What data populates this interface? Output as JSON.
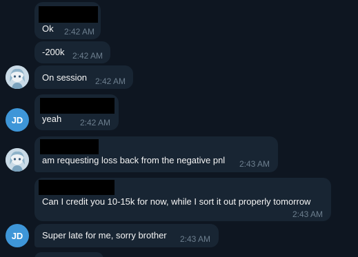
{
  "colors": {
    "background": "#0e1621",
    "bubble": "#182533",
    "text": "#f5f5f5",
    "timestamp": "#6d7f8f",
    "avatar_jd": "#3e96d8",
    "redaction": "#000000"
  },
  "messages": [
    {
      "text": "Ok",
      "time": "2:42 AM",
      "redacted_header": true
    },
    {
      "text": "-200k",
      "time": "2:42 AM",
      "redacted_header": false
    },
    {
      "text": "On session",
      "time": "2:42 AM",
      "redacted_header": false,
      "avatar": "anime-avatar-icon"
    },
    {
      "text": "yeah",
      "time": "2:42 AM",
      "redacted_header": true,
      "avatar": "JD"
    },
    {
      "text": "am requesting loss back from the negative pnl",
      "time": "2:43 AM",
      "redacted_header": true,
      "avatar": "anime-avatar-icon"
    },
    {
      "text": "Can I credit you 10-15k for now, while I sort it out properly tomorrow",
      "time": "2:43 AM",
      "redacted_header": true
    },
    {
      "text": "Super late for me, sorry brother",
      "time": "2:43 AM",
      "redacted_header": false,
      "avatar": "JD"
    }
  ],
  "avatars": {
    "jd_initials": "JD"
  }
}
